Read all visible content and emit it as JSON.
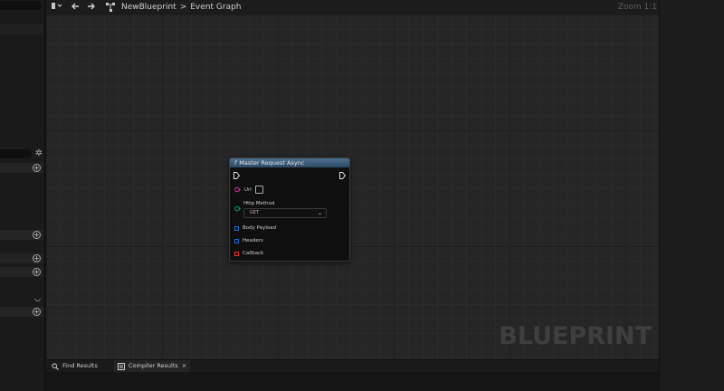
{
  "toolbar": {
    "breadcrumb": [
      "NewBlueprint",
      "Event Graph"
    ],
    "breadcrumb_sep": ">",
    "zoom_label": "Zoom 1:1",
    "back_icon": "arrow-left-icon",
    "forward_icon": "arrow-right-icon"
  },
  "graph": {
    "watermark": "BLUEPRINT"
  },
  "node": {
    "title": "Master Request Async",
    "title_icon": "f",
    "header_color": "#3f6280",
    "pins": {
      "url_label": "Url",
      "http_method_label": "Http Method",
      "http_method_value": "GET",
      "body_payload_label": "Body Payload",
      "headers_label": "Headers",
      "callback_label": "Callback"
    },
    "colors": {
      "url_pin": "#d4329c",
      "http_method_pin": "#0c9a7a",
      "body_payload_pin": "#1e6ed8",
      "headers_pin": "#1e6ed8",
      "callback_pin": "#e83030"
    }
  },
  "bottom_tabs": [
    {
      "label": "Find Results",
      "icon": "search-icon"
    },
    {
      "label": "Compiler Results",
      "icon": "compiler-icon",
      "close": "×"
    }
  ]
}
